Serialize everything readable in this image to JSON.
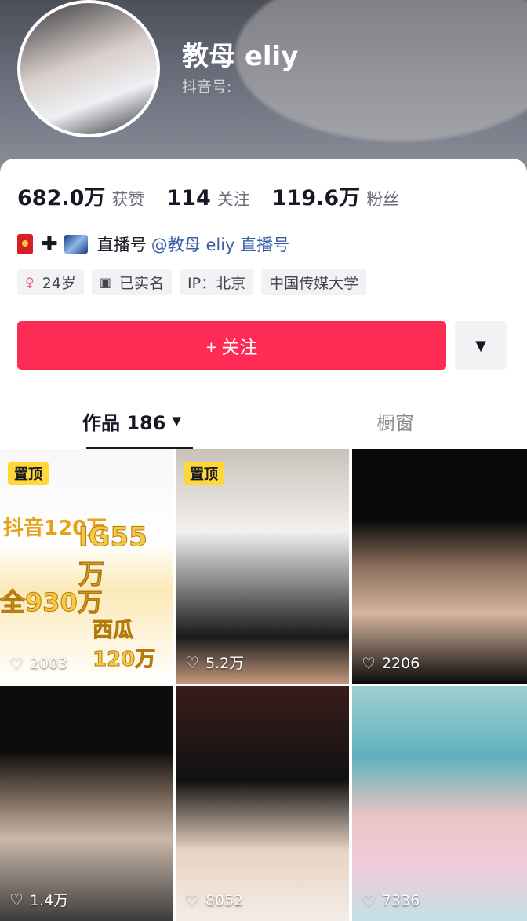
{
  "profile": {
    "username": "教母 eliy",
    "douyin_id_label": "抖音号:"
  },
  "stats": [
    {
      "value": "682.0万",
      "label": "获赞"
    },
    {
      "value": "114",
      "label": "关注"
    },
    {
      "value": "119.6万",
      "label": "粉丝"
    }
  ],
  "live": {
    "plus": "✚",
    "label": "直播号",
    "link": "@教母 eliy 直播号"
  },
  "tags": {
    "age": "24岁",
    "verified": "已实名",
    "ip": "IP：北京",
    "school": "中国传媒大学"
  },
  "actions": {
    "follow_label": "+ 关注",
    "more_glyph": "▼"
  },
  "tabs": {
    "works_label": "作品 186",
    "works_caret": "▼",
    "window_label": "橱窗"
  },
  "videos": [
    {
      "pinned": "置顶",
      "likes": "2003",
      "overlay": [
        "抖音120万",
        "IG55万",
        "全930万",
        "西瓜120万"
      ]
    },
    {
      "pinned": "置顶",
      "likes": "5.2万"
    },
    {
      "likes": "2206"
    },
    {
      "likes": "1.4万"
    },
    {
      "likes": "8052"
    },
    {
      "likes": "7336"
    }
  ],
  "icons": {
    "heart": "♡",
    "female": "♀",
    "id_card": "▣"
  },
  "colors": {
    "accent": "#fe2c55",
    "pin": "#fdd838",
    "link": "#3a5fa8"
  }
}
